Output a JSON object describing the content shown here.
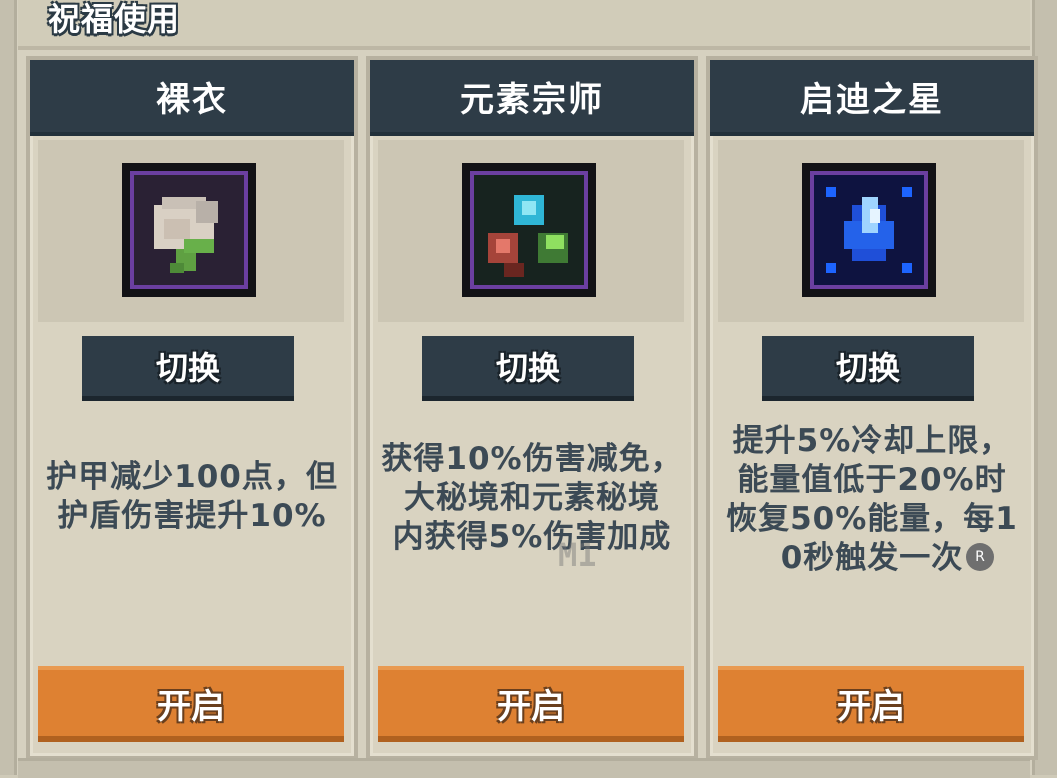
{
  "section": {
    "title": "祝福使用"
  },
  "cards": [
    {
      "name": "裸衣",
      "switch_label": "切换",
      "description": [
        "护甲减少100点，但",
        "护盾伤害提升10%"
      ],
      "open_label": "开启"
    },
    {
      "name": "元素宗师",
      "switch_label": "切换",
      "description": [
        "获得10%伤害减免，",
        "大秘境和元素秘境",
        "内获得5%伤害加成"
      ],
      "open_label": "开启"
    },
    {
      "name": "启迪之星",
      "switch_label": "切换",
      "description": [
        "提升5%冷却上限，",
        "能量值低于20%时",
        "恢复50%能量，每1",
        "0秒触发一次"
      ],
      "open_label": "开启"
    }
  ],
  "overlay": {
    "badge": "R",
    "watermark": "M1"
  },
  "colors": {
    "card_header": "#2e3c47",
    "open_button": "#de8132",
    "text": "#3c4a55"
  }
}
